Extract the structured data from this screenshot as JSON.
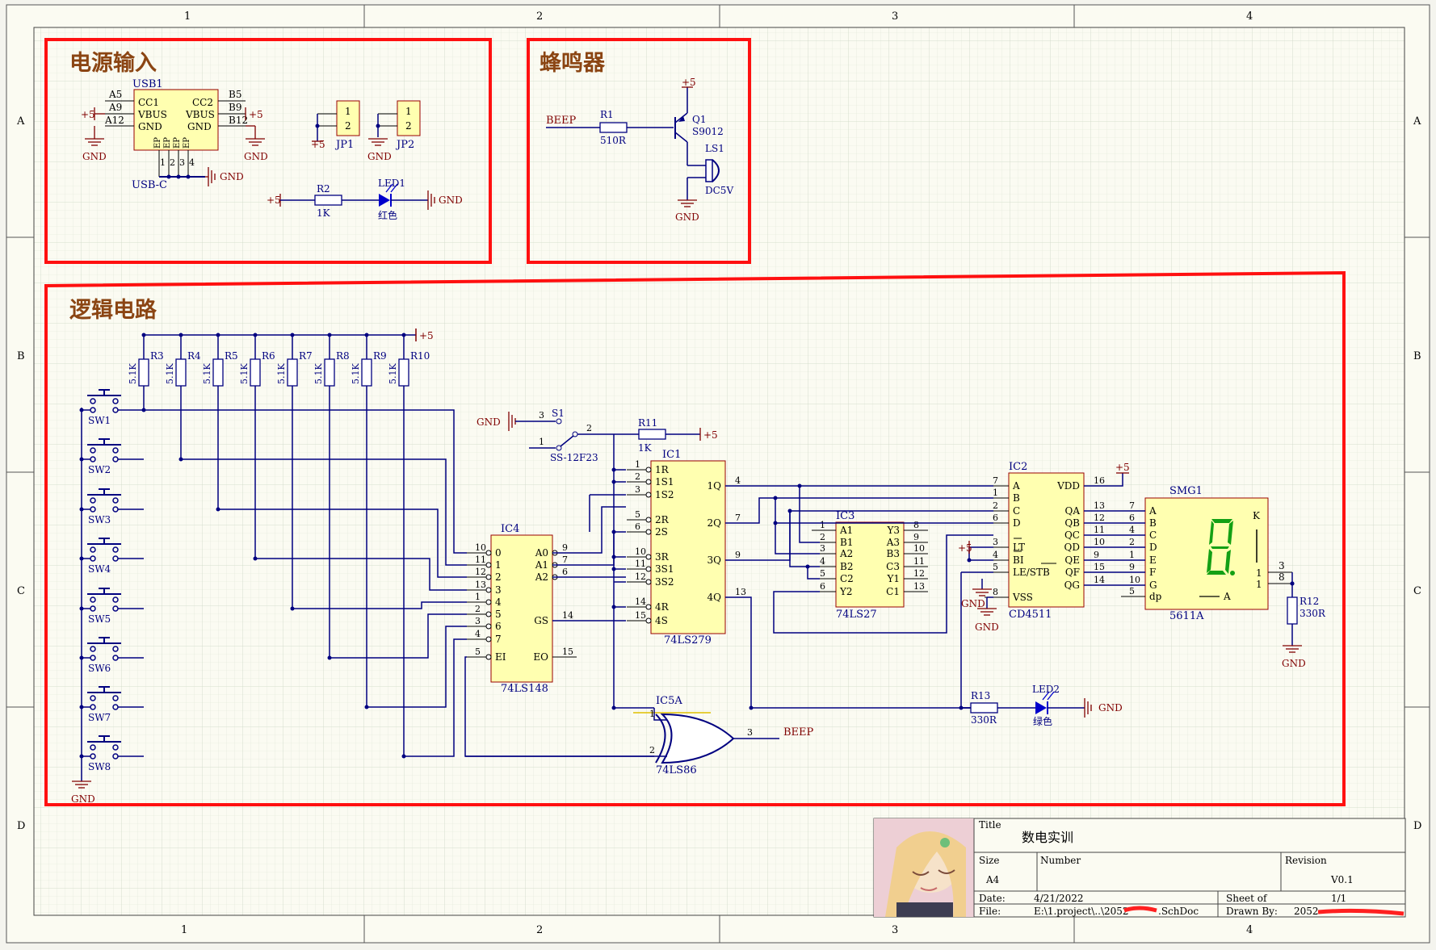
{
  "title_block": {
    "title_label": "Title",
    "title_value": "数电实训",
    "size_label": "Size",
    "size_value": "A4",
    "number_label": "Number",
    "revision_label": "Revision",
    "revision_value": "V0.1",
    "date_label": "Date:",
    "date_value": "4/21/2022",
    "sheet_label": "Sheet   of",
    "sheet_value": "1/1",
    "file_label": "File:",
    "file_value": "E:\\1.project\\..\\2052",
    "file_suffix": ".SchDoc",
    "drawn_label": "Drawn By:",
    "drawn_value": "2052"
  },
  "frame": {
    "columns": [
      "1",
      "2",
      "3",
      "4"
    ],
    "rows": [
      "A",
      "B",
      "C",
      "D"
    ]
  },
  "sections": {
    "power": "电源输入",
    "buzzer": "蜂鸣器",
    "logic": "逻辑电路"
  },
  "nets": {
    "vcc": "+5",
    "gnd": "GND",
    "beep": "BEEP"
  },
  "usb": {
    "ref": "USB1",
    "value": "USB-C",
    "pins_left": [
      "CC1",
      "VBUS",
      "GND"
    ],
    "pins_right": [
      "CC2",
      "VBUS",
      "GND"
    ],
    "left_nums": [
      "A5",
      "A9",
      "A12"
    ],
    "right_nums": [
      "B5",
      "B9",
      "B12"
    ],
    "ep": "EP",
    "bottom_nums": [
      "1",
      "2",
      "3",
      "4"
    ]
  },
  "jumpers": {
    "jp1": "JP1",
    "jp2": "JP2",
    "pin1": "1",
    "pin2": "2"
  },
  "r1": {
    "ref": "R1",
    "value": "510R"
  },
  "r2": {
    "ref": "R2",
    "value": "1K"
  },
  "led1": {
    "ref": "LED1",
    "value": "红色"
  },
  "q1": {
    "ref": "Q1",
    "value": "S9012"
  },
  "ls1": {
    "ref": "LS1",
    "value": "DC5V"
  },
  "pullups": {
    "refs": [
      "R3",
      "R4",
      "R5",
      "R6",
      "R7",
      "R8",
      "R9",
      "R10"
    ],
    "value": "5.1K"
  },
  "switches": [
    "SW1",
    "SW2",
    "SW3",
    "SW4",
    "SW5",
    "SW6",
    "SW7",
    "SW8"
  ],
  "s1": {
    "ref": "S1",
    "value": "SS-12F23",
    "p1": "1",
    "p2": "2",
    "p3": "3"
  },
  "r11": {
    "ref": "R11",
    "value": "1K"
  },
  "ic4": {
    "ref": "IC4",
    "value": "74LS148",
    "inputs": [
      "0",
      "1",
      "2",
      "3",
      "4",
      "5",
      "6",
      "7"
    ],
    "input_pins": [
      "10",
      "11",
      "12",
      "13",
      "1",
      "2",
      "3",
      "4"
    ],
    "outputs": [
      "A0",
      "A1",
      "A2"
    ],
    "output_pins": [
      "9",
      "7",
      "6"
    ],
    "gs": "GS",
    "gs_pin": "14",
    "ei": "EI",
    "ei_pin": "5",
    "eo": "EO",
    "eo_pin": "15"
  },
  "ic1": {
    "ref": "IC1",
    "value": "74LS279",
    "left": [
      "1R",
      "1S1",
      "1S2",
      "2R",
      "2S",
      "3R",
      "3S1",
      "3S2",
      "4R",
      "4S"
    ],
    "left_pins": [
      "1",
      "2",
      "3",
      "5",
      "6",
      "10",
      "11",
      "12",
      "14",
      "15"
    ],
    "right": [
      "1Q",
      "2Q",
      "3Q",
      "4Q"
    ],
    "right_pins": [
      "4",
      "7",
      "9",
      "13"
    ]
  },
  "ic3": {
    "ref": "IC3",
    "value": "74LS27",
    "left": [
      "A1",
      "B1",
      "A2",
      "B2",
      "C2",
      "Y2"
    ],
    "left_pins": [
      "1",
      "2",
      "3",
      "4",
      "5",
      "6"
    ],
    "right": [
      "Y3",
      "A3",
      "B3",
      "C3",
      "Y1",
      "C1"
    ],
    "right_pins": [
      "8",
      "9",
      "10",
      "11",
      "12",
      "13"
    ]
  },
  "ic2": {
    "ref": "IC2",
    "value": "CD4511",
    "left": [
      "A",
      "B",
      "C",
      "D",
      "LT",
      "BI",
      "LE/STB",
      "VSS"
    ],
    "left_pins": [
      "7",
      "1",
      "2",
      "6",
      "3",
      "4",
      "5",
      "8"
    ],
    "right": [
      "VDD",
      "QA",
      "QB",
      "QC",
      "QD",
      "QE",
      "QF",
      "QG"
    ],
    "right_pins": [
      "16",
      "13",
      "12",
      "11",
      "10",
      "9",
      "15",
      "14"
    ]
  },
  "smg1": {
    "ref": "SMG1",
    "value": "5611A",
    "segs": [
      "A",
      "B",
      "C",
      "D",
      "E",
      "F",
      "G",
      "dp"
    ],
    "seg_pins": [
      "7",
      "6",
      "4",
      "2",
      "1",
      "9",
      "10",
      "5"
    ],
    "k": "K",
    "a_label": "A",
    "k_pins": [
      "3",
      "8"
    ],
    "k_nums": [
      "1",
      "1"
    ]
  },
  "r12": {
    "ref": "R12",
    "value": "330R"
  },
  "r13": {
    "ref": "R13",
    "value": "330R"
  },
  "led2": {
    "ref": "LED2",
    "value": "绿色"
  },
  "ic5": {
    "ref": "IC5A",
    "value": "74LS86",
    "p1": "1",
    "p2": "2",
    "p3": "3"
  },
  "colors": {
    "wire": "#000080",
    "part_fill": "#ffffb0",
    "part_stroke": "#9a0000",
    "net_text": "#800000",
    "highlight": "#ff0000",
    "grid_line": "#cfd9c7",
    "sheet_bg": "#fcfcf2"
  }
}
